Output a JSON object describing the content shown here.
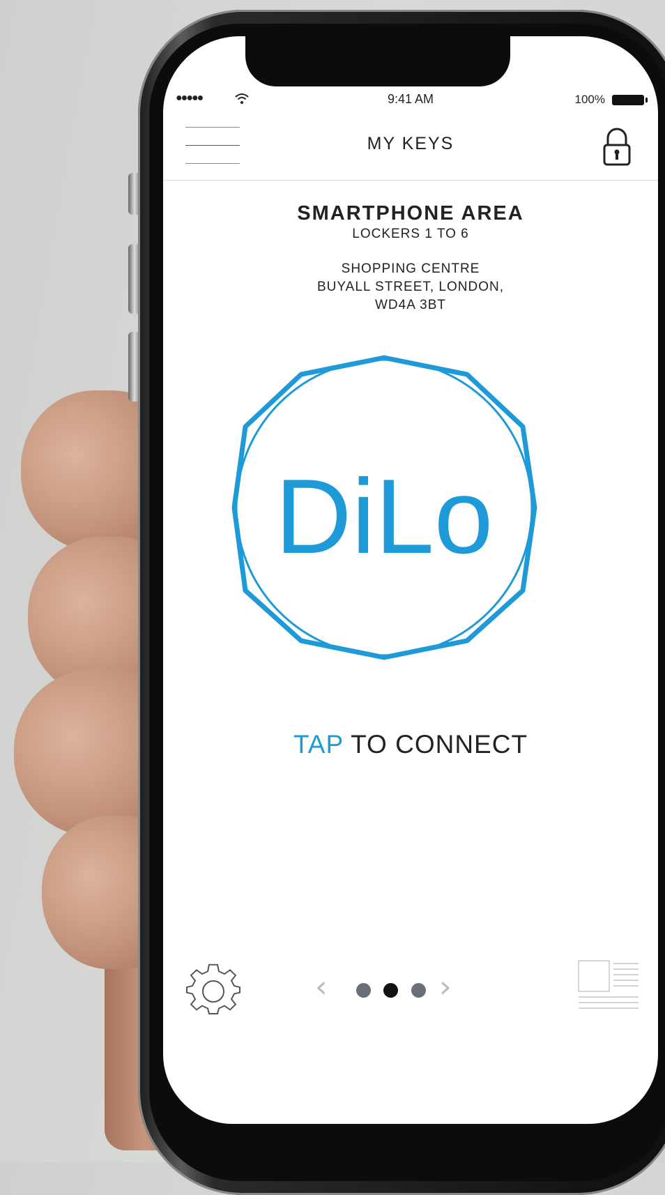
{
  "status_bar": {
    "signal": "●●●●●",
    "time": "9:41 AM",
    "battery_percent": "100%"
  },
  "navbar": {
    "title": "MY KEYS",
    "menu_icon": "hamburger-icon",
    "lock_icon": "padlock-icon"
  },
  "location": {
    "area_name": "SMARTPHONE AREA",
    "lockers": "LOCKERS 1 TO 6",
    "address_line1": "SHOPPING CENTRE",
    "address_line2": "BUYALL STREET, LONDON,",
    "address_line3": "WD4A 3BT"
  },
  "logo": {
    "text": "DiLo",
    "color": "#1e9ad8"
  },
  "connect": {
    "tap_word": "TAP",
    "rest": " TO CONNECT"
  },
  "footer": {
    "settings_icon": "gear-icon",
    "prev_icon": "chevron-left-icon",
    "next_icon": "chevron-right-icon",
    "page_count": 3,
    "active_page": 2,
    "doc_icon": "document-icon"
  },
  "colors": {
    "accent": "#1e9ad8",
    "text": "#222222"
  }
}
